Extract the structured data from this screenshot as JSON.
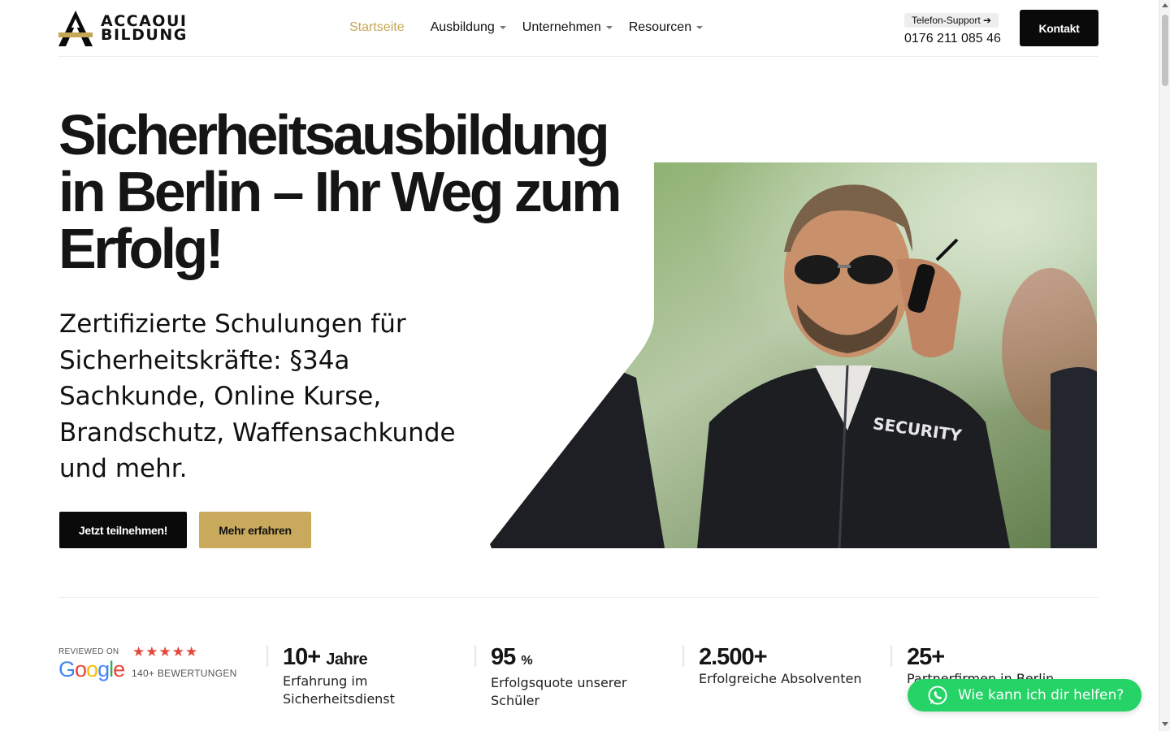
{
  "brand": {
    "line1": "ACCAOUI",
    "line2": "BILDUNG",
    "accent_color": "#c6a758"
  },
  "nav": {
    "items": [
      {
        "label": "Startseite",
        "active": true
      },
      {
        "label": "Ausbildung",
        "dropdown": true
      },
      {
        "label": "Unternehmen",
        "dropdown": true
      },
      {
        "label": "Resourcen",
        "dropdown": true
      }
    ]
  },
  "support": {
    "badge": "Telefon-Support ➔",
    "phone": "0176 211 085 46"
  },
  "header_cta": "Kontakt",
  "hero": {
    "title": "Sicherheitsausbildung in Berlin – Ihr Weg zum Erfolg!",
    "subtitle": "Zertifizierte Schulungen für Sicherheitskräfte: §34a Sachkunde, Online Kurse, Brandschutz, Waffensachkunde und mehr.",
    "primary_button": "Jetzt teilnehmen!",
    "secondary_button": "Mehr erfahren",
    "image_text": "SECURITY"
  },
  "reviews": {
    "reviewed_on": "REVIEWED ON",
    "platform": "Google",
    "stars": 5,
    "count": "140+ BEWERTUNGEN",
    "star_color": "#e4483a"
  },
  "stats": [
    {
      "value": "10+",
      "unit": "Jahre",
      "label": "Erfahrung im Sicherheitsdienst"
    },
    {
      "value": "95",
      "unit": "%",
      "label": "Erfolgsquote unserer Schüler"
    },
    {
      "value": "2.500+",
      "unit": "",
      "label": "Erfolgreiche Absolventen"
    },
    {
      "value": "25+",
      "unit": "",
      "label": "Partnerfirmen in Berlin"
    }
  ],
  "whatsapp": {
    "label": "Wie kann ich dir helfen?",
    "color": "#25d366"
  }
}
